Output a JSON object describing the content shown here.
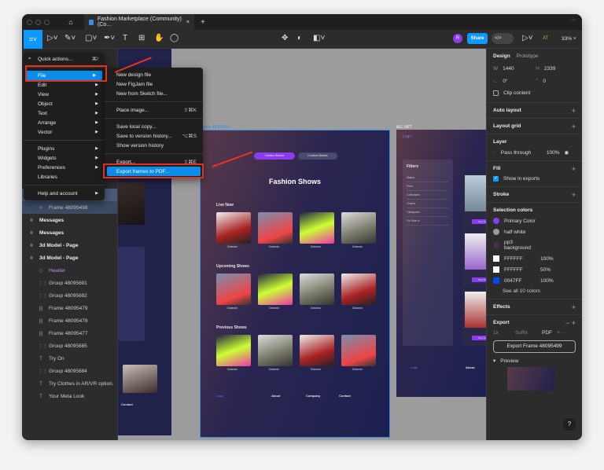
{
  "tabbar": {
    "tab_title": "Fashion Marketplace (Community) (Co…",
    "close": "×",
    "new_tab": "+",
    "more": "···"
  },
  "toolbar": {
    "avatar": "R",
    "share": "Share",
    "zoom": "33%",
    "user_initials": "AT"
  },
  "main_menu": {
    "items": [
      {
        "label": "Quick actions...",
        "shortcut": "⌘/"
      },
      {
        "label": "File"
      },
      {
        "label": "Edit"
      },
      {
        "label": "View"
      },
      {
        "label": "Object"
      },
      {
        "label": "Text"
      },
      {
        "label": "Arrange"
      },
      {
        "label": "Vector"
      },
      {
        "label": "Plugins"
      },
      {
        "label": "Widgets"
      },
      {
        "label": "Preferences"
      },
      {
        "label": "Libraries"
      },
      {
        "label": "Help and account"
      }
    ]
  },
  "file_menu": {
    "items": [
      {
        "label": "New design file",
        "shortcut": ""
      },
      {
        "label": "New FigJam file",
        "shortcut": ""
      },
      {
        "label": "New from Sketch file...",
        "shortcut": ""
      },
      {
        "label": "Place image...",
        "shortcut": "⇧⌘K"
      },
      {
        "label": "Save local copy...",
        "shortcut": ""
      },
      {
        "label": "Save to version history...",
        "shortcut": "⌥⌘S"
      },
      {
        "label": "Show version history",
        "shortcut": ""
      },
      {
        "label": "Export...",
        "shortcut": "⇧⌘E"
      },
      {
        "label": "Export frames to PDF...",
        "shortcut": ""
      }
    ]
  },
  "layers": [
    {
      "label": "Fashion Show",
      "icon": "#",
      "level": 0
    },
    {
      "label": "Fashion Shows",
      "icon": "#",
      "level": 0
    },
    {
      "label": "Frame 48095499",
      "icon": "#",
      "level": 0
    },
    {
      "label": "Frame 48095498",
      "icon": "#",
      "level": 1
    },
    {
      "label": "Messages",
      "icon": "#",
      "level": 0
    },
    {
      "label": "Messages",
      "icon": "#",
      "level": 0
    },
    {
      "label": "3d Model - Page",
      "icon": "#",
      "level": 0
    },
    {
      "label": "3d Model - Page",
      "icon": "#",
      "level": 0
    },
    {
      "label": "Header",
      "icon": "◇",
      "level": 1
    },
    {
      "label": "Group 48095691",
      "icon": "⋮⋮",
      "level": 1
    },
    {
      "label": "Group 48095692",
      "icon": "⋮⋮",
      "level": 1
    },
    {
      "label": "Frame 48095479",
      "icon": "|||",
      "level": 1
    },
    {
      "label": "Frame 48095478",
      "icon": "|||",
      "level": 1
    },
    {
      "label": "Frame 48095477",
      "icon": "|||",
      "level": 1
    },
    {
      "label": "Group 48095685",
      "icon": "⋮⋮",
      "level": 1
    },
    {
      "label": "Try On",
      "icon": "T",
      "level": 1
    },
    {
      "label": "Group 48095684",
      "icon": "⋮⋮",
      "level": 1
    },
    {
      "label": "Try Clothes in AR/VR option.",
      "icon": "T",
      "level": 1
    },
    {
      "label": "Your Meta Look",
      "icon": "T",
      "level": 1
    }
  ],
  "canvas": {
    "frame_label_center": "Frame 48095499",
    "frame_label_right": "ALL NFT",
    "center": {
      "btn1": "Fashion Brands",
      "btn2": "Creators Brands",
      "title": "Fashion Shows",
      "live": "Live Now",
      "upcoming": "Upcoming Shows",
      "previous": "Previous Shows",
      "creator": "Dolando",
      "footer": {
        "logo": "Logo",
        "about": "About",
        "company": "Company",
        "contact": "Contact"
      }
    },
    "right": {
      "logo": "Logo",
      "filters": "Filters",
      "filter_items": [
        "Status",
        "Price",
        "Collections",
        "Chains",
        "Categories",
        "On Sale In"
      ],
      "buy": "Buy Now",
      "about": "About"
    }
  },
  "design_panel": {
    "tabs": [
      "Design",
      "Prototype"
    ],
    "w_label": "W",
    "w": "1440",
    "h_label": "H",
    "h": "2339",
    "rotation": "0°",
    "radius": "0",
    "clip_content": "Clip content",
    "auto_layout": "Auto layout",
    "layout_grid": "Layout grid",
    "layer": "Layer",
    "blend": "Pass through",
    "opacity": "100%",
    "fill": "Fill",
    "show_in_exports": "Show in exports",
    "stroke": "Stroke",
    "selection_colors": "Selection colors",
    "colors": [
      {
        "name": "Primary Color",
        "hex": "#8a3cf0",
        "opacity": ""
      },
      {
        "name": "half white",
        "hex": "#9a9a9a",
        "opacity": ""
      },
      {
        "name": "pp3 background",
        "hex": "#4a3050",
        "opacity": ""
      },
      {
        "name": "FFFFFF",
        "hex": "#ffffff",
        "opacity": "100%"
      },
      {
        "name": "FFFFFF",
        "hex": "#ffffff",
        "opacity": "50%"
      },
      {
        "name": "0047FF",
        "hex": "#0047ff",
        "opacity": "100%"
      }
    ],
    "see_all": "See all 10 colors",
    "effects": "Effects",
    "export": "Export",
    "scale": "1x",
    "suffix": "Suffix",
    "format": "PDF",
    "export_button": "Export Frame 48095499",
    "preview": "Preview",
    "help": "?"
  }
}
